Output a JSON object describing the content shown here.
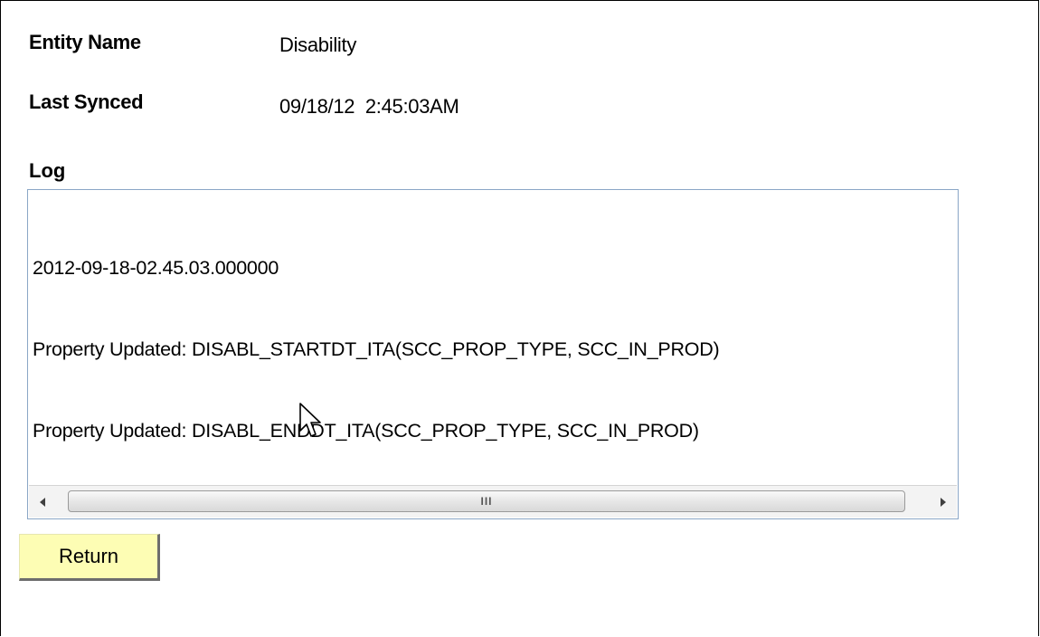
{
  "fields": {
    "entity_name_label": "Entity Name",
    "entity_name_value": "Disability",
    "last_synced_label": "Last Synced",
    "last_synced_value": "09/18/12  2:45:03AM"
  },
  "log": {
    "label": "Log",
    "lines": [
      "2012-09-18-02.45.03.000000",
      "Property Updated: DISABL_STARTDT_ITA(SCC_PROP_TYPE, SCC_IN_PROD)",
      "Property Updated: DISABL_ENDDT_ITA(SCC_PROP_TYPE, SCC_IN_PROD)"
    ],
    "scrollbar": {
      "left_arrow_icon": "triangle-left",
      "right_arrow_icon": "triangle-right",
      "grip_glyph": "III"
    }
  },
  "actions": {
    "return_label": "Return"
  },
  "icons": {
    "cursor": "mouse-pointer-arrow"
  },
  "colors": {
    "button_bg": "#fdfdb4",
    "log_border": "#8aa6c6"
  }
}
